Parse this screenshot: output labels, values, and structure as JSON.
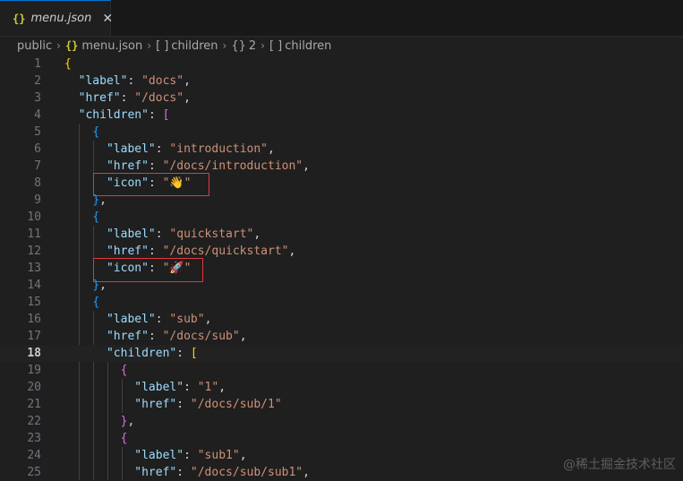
{
  "tab": {
    "icon": "{}",
    "filename": "menu.json",
    "close": "✕"
  },
  "breadcrumb": {
    "folder": "public",
    "file_icon": "{}",
    "file": "menu.json",
    "items": [
      {
        "symbol": "[ ]",
        "label": "children"
      },
      {
        "symbol": "{}",
        "label": "2"
      },
      {
        "symbol": "[ ]",
        "label": "children"
      }
    ]
  },
  "editor": {
    "active_line": 18,
    "lines": [
      {
        "n": "1"
      },
      {
        "n": "2"
      },
      {
        "n": "3"
      },
      {
        "n": "4"
      },
      {
        "n": "5"
      },
      {
        "n": "6"
      },
      {
        "n": "7"
      },
      {
        "n": "8"
      },
      {
        "n": "9"
      },
      {
        "n": "10"
      },
      {
        "n": "11"
      },
      {
        "n": "12"
      },
      {
        "n": "13"
      },
      {
        "n": "14"
      },
      {
        "n": "15"
      },
      {
        "n": "16"
      },
      {
        "n": "17"
      },
      {
        "n": "18"
      },
      {
        "n": "19"
      },
      {
        "n": "20"
      },
      {
        "n": "21"
      },
      {
        "n": "22"
      },
      {
        "n": "23"
      },
      {
        "n": "24"
      },
      {
        "n": "25"
      }
    ],
    "tokens": {
      "label": "\"label\"",
      "href": "\"href\"",
      "children": "\"children\"",
      "icon": "\"icon\"",
      "docs": "\"docs\"",
      "docs_href": "\"/docs\"",
      "introduction": "\"introduction\"",
      "intro_href": "\"/docs/introduction\"",
      "icon_wave": "\"👋\"",
      "quickstart": "\"quickstart\"",
      "quick_href": "\"/docs/quickstart\"",
      "icon_rocket": "\"🚀\"",
      "sub": "\"sub\"",
      "sub_href": "\"/docs/sub\"",
      "one": "\"1\"",
      "one_href": "\"/docs/sub/1\"",
      "sub1": "\"sub1\"",
      "sub1_href": "\"/docs/sub/sub1\""
    }
  },
  "watermark": "@稀土掘金技术社区",
  "colors": {
    "highlight_box": "#e0393e",
    "key": "#9cdcfe",
    "string": "#ce9178",
    "tab_accent": "#0078d4"
  }
}
